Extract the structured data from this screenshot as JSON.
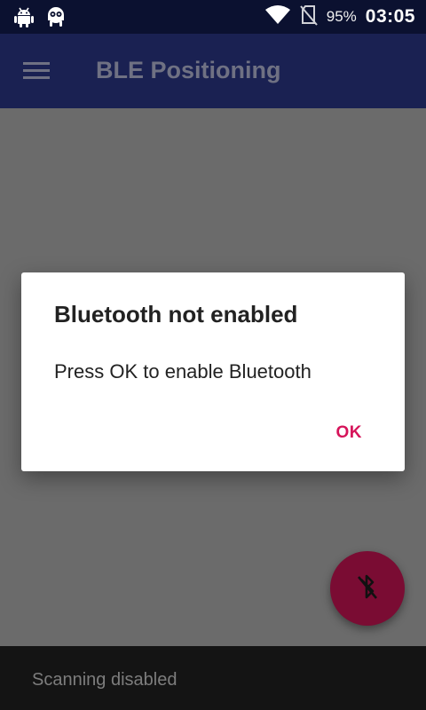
{
  "status_bar": {
    "icons_left": [
      "android-icon",
      "ghost-icon"
    ],
    "icons_right": [
      "wifi-icon",
      "no-sim-icon"
    ],
    "battery_percent": "95%",
    "time": "03:05"
  },
  "app_bar": {
    "menu_icon": "hamburger-menu-icon",
    "title": "BLE Positioning"
  },
  "dialog": {
    "title": "Bluetooth not enabled",
    "message": "Press OK to enable Bluetooth",
    "ok_label": "OK"
  },
  "fab": {
    "icon": "bluetooth-disabled-icon"
  },
  "snackbar": {
    "text": "Scanning disabled"
  },
  "colors": {
    "status_bar_bg": "#0b1130",
    "app_bar_bg": "#1a2152",
    "scrim_bg": "#6b6b6b",
    "accent": "#d6145a",
    "fab_bg": "#7a0c33",
    "snackbar_bg": "#141414"
  }
}
